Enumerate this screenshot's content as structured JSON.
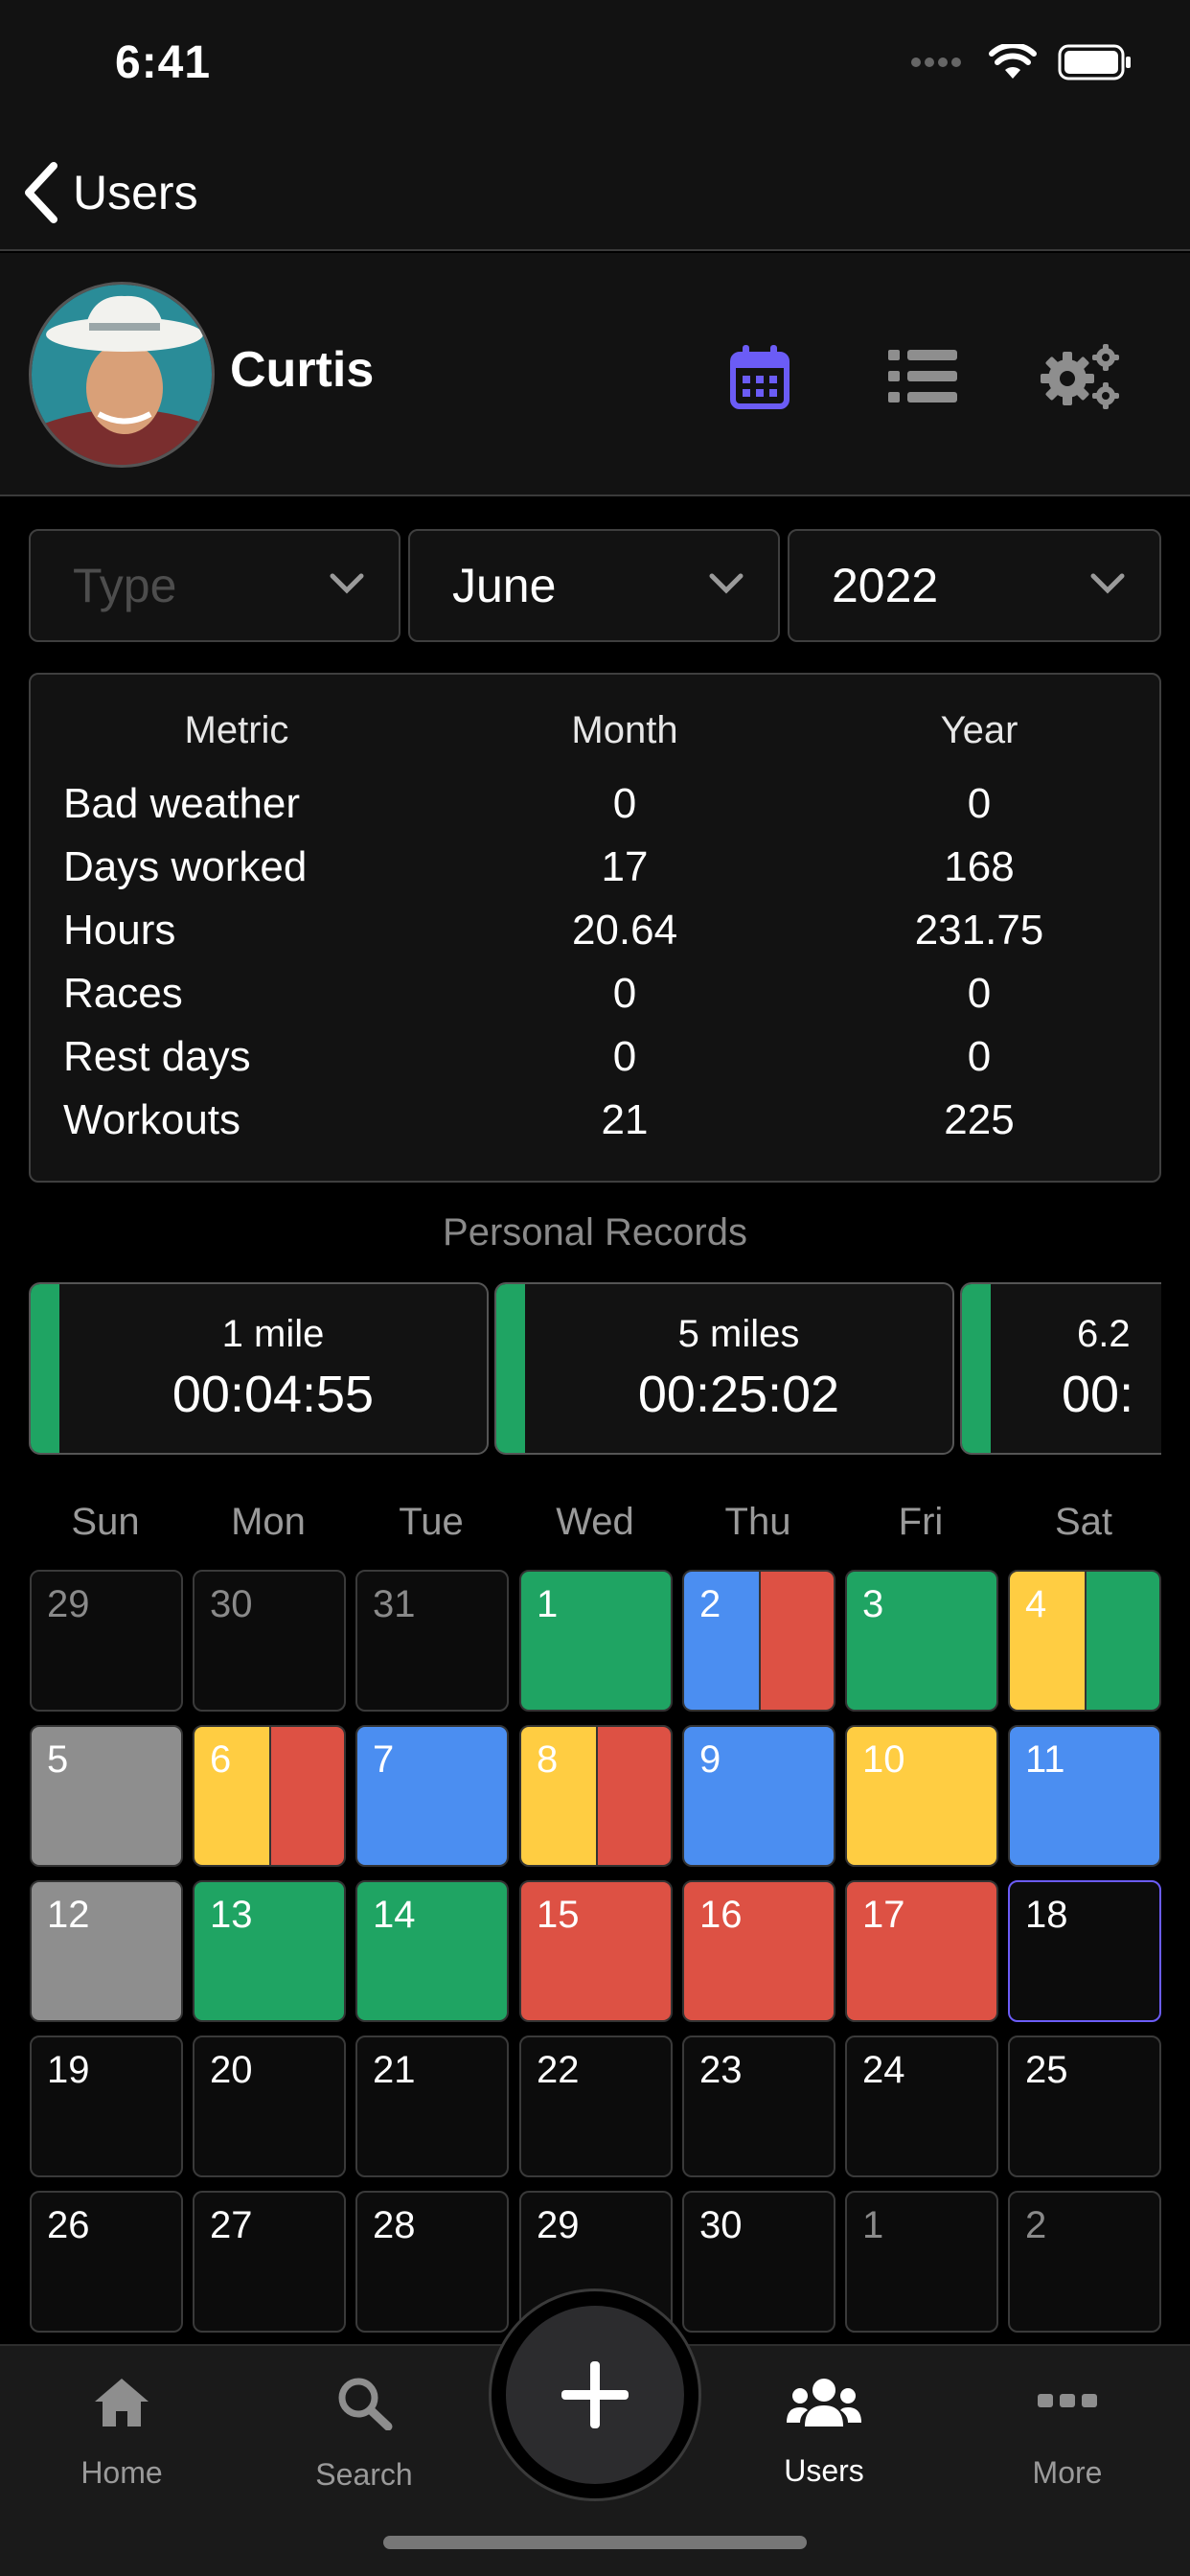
{
  "status_bar": {
    "time": "6:41"
  },
  "nav": {
    "back_label": "Users"
  },
  "profile": {
    "name": "Curtis"
  },
  "filters": {
    "type_placeholder": "Type",
    "month": "June",
    "year": "2022"
  },
  "metrics": {
    "headers": [
      "Metric",
      "Month",
      "Year"
    ],
    "rows": [
      {
        "metric": "Bad weather",
        "month": "0",
        "year": "0"
      },
      {
        "metric": "Days worked",
        "month": "17",
        "year": "168"
      },
      {
        "metric": "Hours",
        "month": "20.64",
        "year": "231.75"
      },
      {
        "metric": "Races",
        "month": "0",
        "year": "0"
      },
      {
        "metric": "Rest days",
        "month": "0",
        "year": "0"
      },
      {
        "metric": "Workouts",
        "month": "21",
        "year": "225"
      }
    ]
  },
  "personal_records": {
    "title": "Personal Records",
    "items": [
      {
        "label": "1 mile",
        "value": "00:04:55"
      },
      {
        "label": "5 miles",
        "value": "00:25:02"
      },
      {
        "label": "6.2",
        "value": "00:"
      }
    ]
  },
  "calendar": {
    "weekdays": [
      "Sun",
      "Mon",
      "Tue",
      "Wed",
      "Thu",
      "Fri",
      "Sat"
    ],
    "colors": {
      "green": "#1fa463",
      "blue": "#4b8ef1",
      "red": "#dd5144",
      "yellow": "#ffcd42",
      "gray": "#8e8e8e",
      "today_border": "#6b5cf6"
    },
    "days": [
      {
        "n": "29",
        "other": true,
        "fill": []
      },
      {
        "n": "30",
        "other": true,
        "fill": []
      },
      {
        "n": "31",
        "other": true,
        "fill": []
      },
      {
        "n": "1",
        "fill": [
          "green"
        ]
      },
      {
        "n": "2",
        "fill": [
          "blue",
          "red"
        ]
      },
      {
        "n": "3",
        "fill": [
          "green"
        ]
      },
      {
        "n": "4",
        "fill": [
          "yellow",
          "green"
        ]
      },
      {
        "n": "5",
        "fill": [
          "gray"
        ]
      },
      {
        "n": "6",
        "fill": [
          "yellow",
          "red"
        ]
      },
      {
        "n": "7",
        "fill": [
          "blue"
        ]
      },
      {
        "n": "8",
        "fill": [
          "yellow",
          "red"
        ]
      },
      {
        "n": "9",
        "fill": [
          "blue"
        ]
      },
      {
        "n": "10",
        "fill": [
          "yellow"
        ]
      },
      {
        "n": "11",
        "fill": [
          "blue"
        ]
      },
      {
        "n": "12",
        "fill": [
          "gray"
        ]
      },
      {
        "n": "13",
        "fill": [
          "green"
        ]
      },
      {
        "n": "14",
        "fill": [
          "green"
        ]
      },
      {
        "n": "15",
        "fill": [
          "red"
        ]
      },
      {
        "n": "16",
        "fill": [
          "red"
        ]
      },
      {
        "n": "17",
        "fill": [
          "red"
        ]
      },
      {
        "n": "18",
        "fill": [],
        "today": true
      },
      {
        "n": "19",
        "fill": []
      },
      {
        "n": "20",
        "fill": []
      },
      {
        "n": "21",
        "fill": []
      },
      {
        "n": "22",
        "fill": []
      },
      {
        "n": "23",
        "fill": []
      },
      {
        "n": "24",
        "fill": []
      },
      {
        "n": "25",
        "fill": []
      },
      {
        "n": "26",
        "fill": []
      },
      {
        "n": "27",
        "fill": []
      },
      {
        "n": "28",
        "fill": []
      },
      {
        "n": "29",
        "fill": []
      },
      {
        "n": "30",
        "fill": []
      },
      {
        "n": "1",
        "other": true,
        "fill": []
      },
      {
        "n": "2",
        "other": true,
        "fill": []
      }
    ]
  },
  "tabbar": {
    "home": "Home",
    "search": "Search",
    "users": "Users",
    "more": "More",
    "add_icon": "plus-icon"
  },
  "accent_color": "#6b5cf6"
}
